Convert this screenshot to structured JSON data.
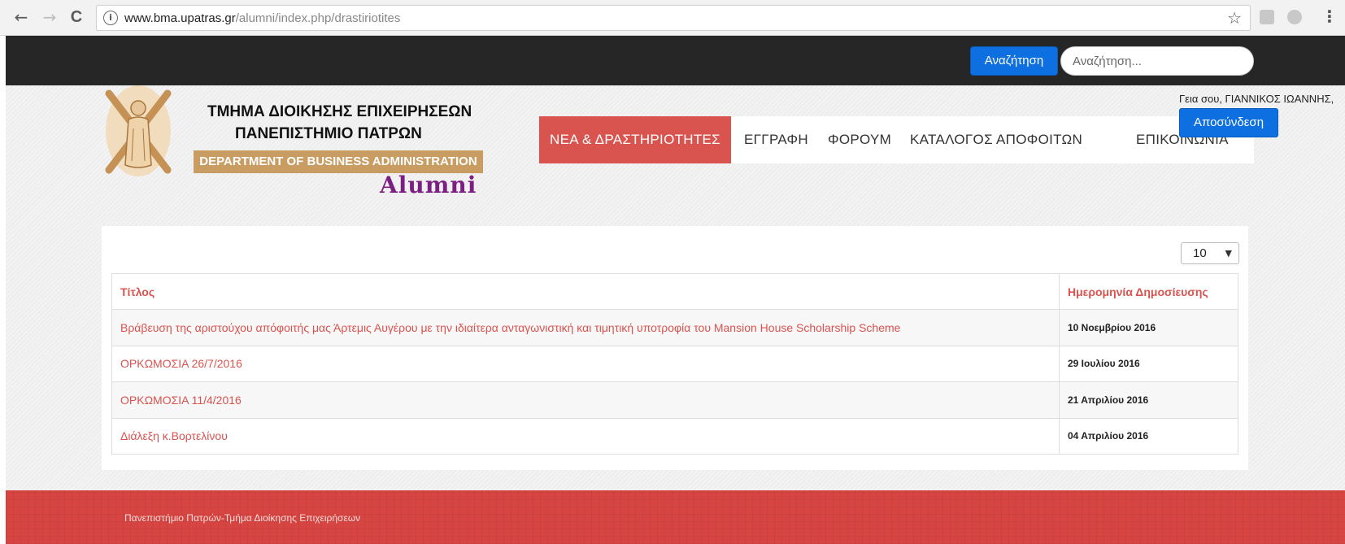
{
  "browser": {
    "back_icon": "←",
    "forward_icon": "→",
    "reload_icon": "C",
    "info_icon": "i",
    "url_host": "www.bma.upatras.gr",
    "url_path": "/alumni/index.php/drastiriotites",
    "star_icon": "☆",
    "menu_icon": "⋮"
  },
  "topbar": {
    "search_button": "Αναζήτηση",
    "search_placeholder": "Αναζήτηση..."
  },
  "logo": {
    "line1": "ΤΜΗΜΑ ΔΙΟΙΚΗΣΗΣ ΕΠΙΧΕΙΡΗΣΕΩΝ",
    "line2": "ΠΑΝΕΠΙΣΤΗΜΙΟ ΠΑΤΡΩΝ",
    "band": "DEPARTMENT OF BUSINESS ADMINISTRATION",
    "alumni": "Alumni"
  },
  "user": {
    "greeting": "Γεια σου, ΓΙΑΝΝΙΚΟΣ ΙΩΑΝΝΗΣ,",
    "logout": "Αποσύνδεση"
  },
  "nav": {
    "items": [
      {
        "label": "ΝΕΑ & ΔΡΑΣΤΗΡΙΟΤΗΤΕΣ",
        "active": true
      },
      {
        "label": "ΕΓΓΡΑΦΗ",
        "active": false
      },
      {
        "label": "ΦΟΡΟΥΜ",
        "active": false
      },
      {
        "label": "ΚΑΤΑΛΟΓΟΣ ΑΠΟΦΟΙΤΩΝ",
        "active": false
      },
      {
        "label": "ΕΠΙΚΟΙΝΩΝΙΑ",
        "active": false
      }
    ]
  },
  "table": {
    "per_page": "10",
    "caret": "▼",
    "headers": {
      "title": "Τίτλος",
      "date": "Ημερομηνία Δημοσίευσης"
    },
    "rows": [
      {
        "title": "Βράβευση της αριστούχου απόφοιτής μας Άρτεμις Αυγέρου με την ιδιαίτερα ανταγωνιστική και τιμητική υποτροφία του Mansion House Scholarship Scheme",
        "date": "10 Νοεμβρίου 2016"
      },
      {
        "title": "ΟΡΚΩΜΟΣΙΑ 26/7/2016",
        "date": "29 Ιουλίου 2016"
      },
      {
        "title": "ΟΡΚΩΜΟΣΙΑ 11/4/2016",
        "date": "21 Απριλίου 2016"
      },
      {
        "title": "Διάλεξη κ.Βορτελίνου",
        "date": "04 Απριλίου 2016"
      }
    ]
  },
  "footer": {
    "text": "Πανεπιστήμιο Πατρών-Τμήμα Διοίκησης Επιχειρήσεων"
  },
  "colors": {
    "accent_red": "#d9534f",
    "button_blue": "#0d6fe0",
    "topbar_dark": "#262626",
    "logo_gold": "#c99c62",
    "alumni_purple": "#7c1f83"
  }
}
